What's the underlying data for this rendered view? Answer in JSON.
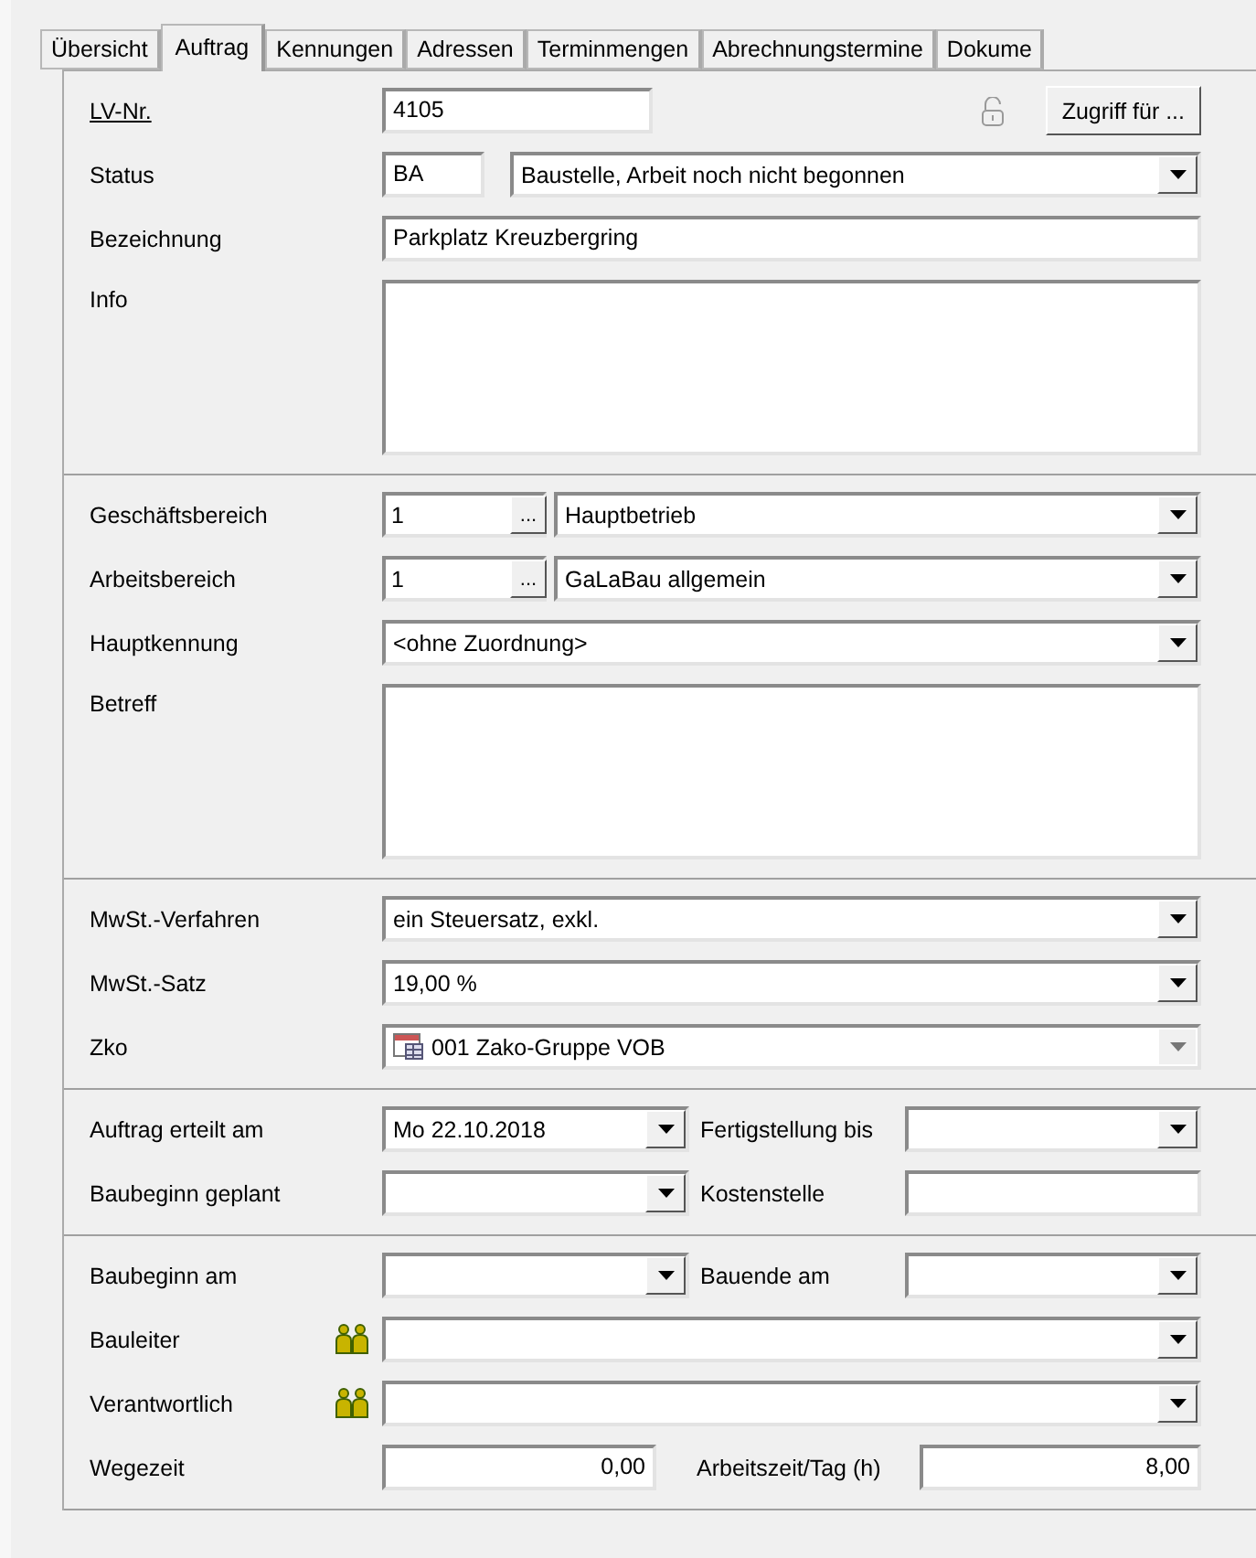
{
  "tabs": [
    {
      "label": "Übersicht",
      "selected": false
    },
    {
      "label": "Auftrag",
      "selected": true
    },
    {
      "label": "Kennungen",
      "selected": false
    },
    {
      "label": "Adressen",
      "selected": false
    },
    {
      "label": "Terminmengen",
      "selected": false
    },
    {
      "label": "Abrechnungstermine",
      "selected": false
    },
    {
      "label": "Dokume",
      "selected": false
    }
  ],
  "sections": [
    {
      "rows": [
        {
          "kind": "access",
          "label": "LV-Nr.",
          "value": "4105",
          "button": "Zugriff für ..."
        },
        {
          "kind": "status",
          "label": "Status",
          "code": "BA",
          "value": "Baustelle, Arbeit noch nicht begonnen"
        },
        {
          "kind": "text",
          "label": "Bezeichnung",
          "value": "Parkplatz Kreuzbergring"
        },
        {
          "kind": "memo",
          "label": "Info"
        }
      ]
    },
    {
      "rows": [
        {
          "kind": "lookup",
          "label": "Geschäftsbereich",
          "code": "1",
          "button": "...",
          "value": "Hauptbetrieb"
        },
        {
          "kind": "lookup",
          "label": "Arbeitsbereich",
          "code": "1",
          "button": "...",
          "value": "GaLaBau allgemein"
        },
        {
          "kind": "combo",
          "label": "Hauptkennung",
          "value": "<ohne Zuordnung>"
        },
        {
          "kind": "memo",
          "label": "Betreff"
        }
      ]
    },
    {
      "rows": [
        {
          "kind": "combo",
          "label": "MwSt.-Verfahren",
          "value": "ein Steuersatz, exkl."
        },
        {
          "kind": "combo",
          "label": "MwSt.-Satz",
          "value": "19,00  %"
        },
        {
          "kind": "icon-combo",
          "label": "Zko",
          "value": "001 Zako-Gruppe VOB",
          "disabled": true
        }
      ]
    },
    {
      "rows": [
        {
          "kind": "pair",
          "label": "Auftrag erteilt am",
          "value": "Mo   22.10.2018",
          "right_label": "Fertigstellung bis",
          "right": {
            "kind": "combo"
          }
        },
        {
          "kind": "pair",
          "label": "Baubeginn geplant",
          "right_label": "Kostenstelle",
          "right": {
            "kind": "text"
          }
        }
      ]
    },
    {
      "rows": [
        {
          "kind": "pair",
          "label": "Baubeginn am",
          "right_label": "Bauende am",
          "right": {
            "kind": "combo"
          }
        },
        {
          "kind": "person",
          "label": "Bauleiter"
        },
        {
          "kind": "person",
          "label": "Verantwortlich"
        },
        {
          "kind": "numbers",
          "label": "Wegezeit",
          "value": "0,00",
          "right_label": "Arbeitszeit/Tag (h)",
          "right_value": "8,00"
        }
      ]
    }
  ]
}
